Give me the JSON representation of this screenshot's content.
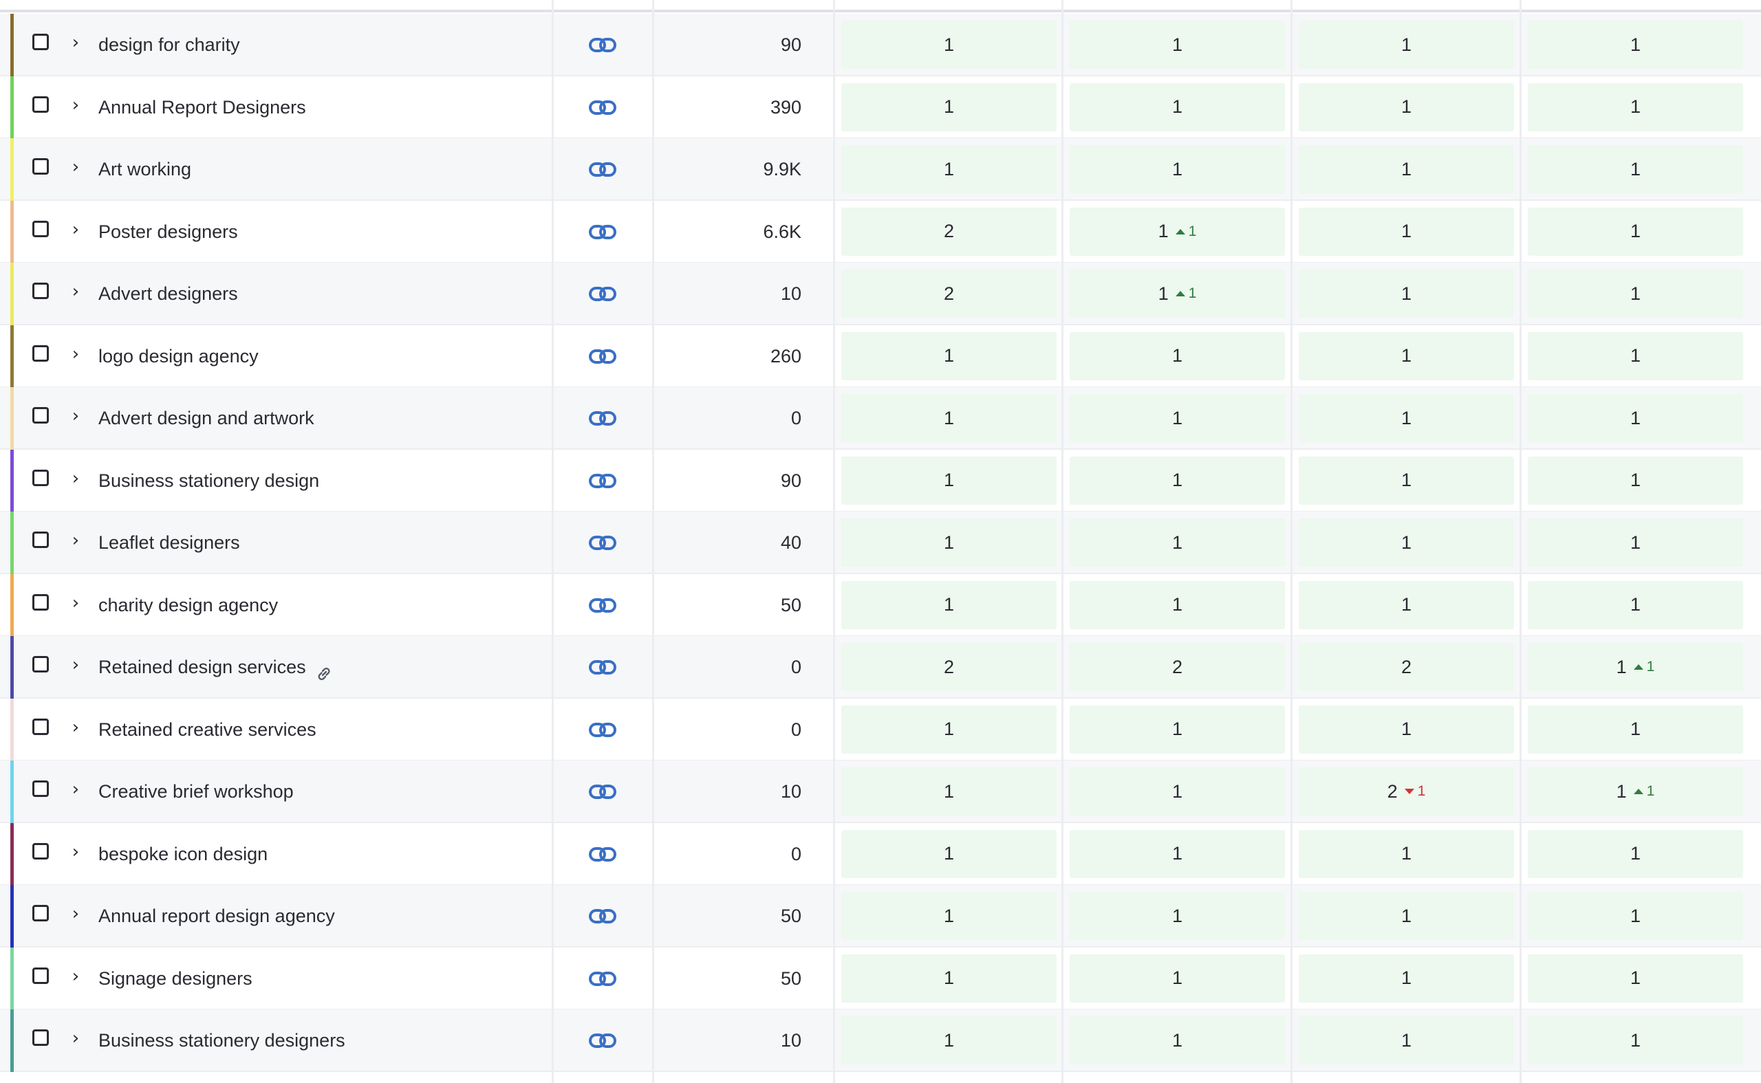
{
  "colors": {
    "accent_link": "#3a6fc4",
    "pos_cell_bg": "#edf8ee",
    "change_up": "#2f7d3f",
    "change_down": "#d0343a"
  },
  "icons": {
    "url": "link-icon",
    "expand": "chevron-right-icon",
    "keyword_link": "link-icon"
  },
  "rows": [
    {
      "keyword": "design for charity",
      "volume": "90",
      "stripe": "#8a6c2e",
      "positions": [
        {
          "value": "1",
          "change": "",
          "dir": ""
        },
        {
          "value": "1",
          "change": "",
          "dir": ""
        },
        {
          "value": "1",
          "change": "",
          "dir": ""
        },
        {
          "value": "1",
          "change": "",
          "dir": ""
        }
      ]
    },
    {
      "keyword": "Annual Report Designers",
      "volume": "390",
      "stripe": "#6fd35a",
      "positions": [
        {
          "value": "1",
          "change": "",
          "dir": ""
        },
        {
          "value": "1",
          "change": "",
          "dir": ""
        },
        {
          "value": "1",
          "change": "",
          "dir": ""
        },
        {
          "value": "1",
          "change": "",
          "dir": ""
        }
      ]
    },
    {
      "keyword": "Art working",
      "volume": "9.9K",
      "stripe": "#f0ef63",
      "positions": [
        {
          "value": "1",
          "change": "",
          "dir": ""
        },
        {
          "value": "1",
          "change": "",
          "dir": ""
        },
        {
          "value": "1",
          "change": "",
          "dir": ""
        },
        {
          "value": "1",
          "change": "",
          "dir": ""
        }
      ]
    },
    {
      "keyword": "Poster designers",
      "volume": "6.6K",
      "stripe": "#efb98f",
      "positions": [
        {
          "value": "2",
          "change": "",
          "dir": ""
        },
        {
          "value": "1",
          "change": "1",
          "dir": "up"
        },
        {
          "value": "1",
          "change": "",
          "dir": ""
        },
        {
          "value": "1",
          "change": "",
          "dir": ""
        }
      ]
    },
    {
      "keyword": "Advert designers",
      "volume": "10",
      "stripe": "#ecea5c",
      "positions": [
        {
          "value": "2",
          "change": "",
          "dir": ""
        },
        {
          "value": "1",
          "change": "1",
          "dir": "up"
        },
        {
          "value": "1",
          "change": "",
          "dir": ""
        },
        {
          "value": "1",
          "change": "",
          "dir": ""
        }
      ]
    },
    {
      "keyword": "logo design agency",
      "volume": "260",
      "stripe": "#8d7a35",
      "positions": [
        {
          "value": "1",
          "change": "",
          "dir": ""
        },
        {
          "value": "1",
          "change": "",
          "dir": ""
        },
        {
          "value": "1",
          "change": "",
          "dir": ""
        },
        {
          "value": "1",
          "change": "",
          "dir": ""
        }
      ]
    },
    {
      "keyword": "Advert design and artwork",
      "volume": "0",
      "stripe": "#f3d9a3",
      "positions": [
        {
          "value": "1",
          "change": "",
          "dir": ""
        },
        {
          "value": "1",
          "change": "",
          "dir": ""
        },
        {
          "value": "1",
          "change": "",
          "dir": ""
        },
        {
          "value": "1",
          "change": "",
          "dir": ""
        }
      ]
    },
    {
      "keyword": "Business stationery design",
      "volume": "90",
      "stripe": "#7b4cd6",
      "positions": [
        {
          "value": "1",
          "change": "",
          "dir": ""
        },
        {
          "value": "1",
          "change": "",
          "dir": ""
        },
        {
          "value": "1",
          "change": "",
          "dir": ""
        },
        {
          "value": "1",
          "change": "",
          "dir": ""
        }
      ]
    },
    {
      "keyword": "Leaflet designers",
      "volume": "40",
      "stripe": "#74d86a",
      "positions": [
        {
          "value": "1",
          "change": "",
          "dir": ""
        },
        {
          "value": "1",
          "change": "",
          "dir": ""
        },
        {
          "value": "1",
          "change": "",
          "dir": ""
        },
        {
          "value": "1",
          "change": "",
          "dir": ""
        }
      ]
    },
    {
      "keyword": "charity design agency",
      "volume": "50",
      "stripe": "#f2a94e",
      "positions": [
        {
          "value": "1",
          "change": "",
          "dir": ""
        },
        {
          "value": "1",
          "change": "",
          "dir": ""
        },
        {
          "value": "1",
          "change": "",
          "dir": ""
        },
        {
          "value": "1",
          "change": "",
          "dir": ""
        }
      ]
    },
    {
      "keyword": "Retained design services",
      "volume": "0",
      "stripe": "#4b4aa8",
      "keyword_link": true,
      "positions": [
        {
          "value": "2",
          "change": "",
          "dir": ""
        },
        {
          "value": "2",
          "change": "",
          "dir": ""
        },
        {
          "value": "2",
          "change": "",
          "dir": ""
        },
        {
          "value": "1",
          "change": "1",
          "dir": "up"
        }
      ]
    },
    {
      "keyword": "Retained creative services",
      "volume": "0",
      "stripe": "#f2dada",
      "positions": [
        {
          "value": "1",
          "change": "",
          "dir": ""
        },
        {
          "value": "1",
          "change": "",
          "dir": ""
        },
        {
          "value": "1",
          "change": "",
          "dir": ""
        },
        {
          "value": "1",
          "change": "",
          "dir": ""
        }
      ]
    },
    {
      "keyword": "Creative brief workshop",
      "volume": "10",
      "stripe": "#6cd5ef",
      "positions": [
        {
          "value": "1",
          "change": "",
          "dir": ""
        },
        {
          "value": "1",
          "change": "",
          "dir": ""
        },
        {
          "value": "2",
          "change": "1",
          "dir": "down"
        },
        {
          "value": "1",
          "change": "1",
          "dir": "up"
        }
      ]
    },
    {
      "keyword": "bespoke icon design",
      "volume": "0",
      "stripe": "#8b2a57",
      "positions": [
        {
          "value": "1",
          "change": "",
          "dir": ""
        },
        {
          "value": "1",
          "change": "",
          "dir": ""
        },
        {
          "value": "1",
          "change": "",
          "dir": ""
        },
        {
          "value": "1",
          "change": "",
          "dir": ""
        }
      ]
    },
    {
      "keyword": "Annual report design agency",
      "volume": "50",
      "stripe": "#2532b6",
      "positions": [
        {
          "value": "1",
          "change": "",
          "dir": ""
        },
        {
          "value": "1",
          "change": "",
          "dir": ""
        },
        {
          "value": "1",
          "change": "",
          "dir": ""
        },
        {
          "value": "1",
          "change": "",
          "dir": ""
        }
      ]
    },
    {
      "keyword": "Signage designers",
      "volume": "50",
      "stripe": "#76d8a0",
      "positions": [
        {
          "value": "1",
          "change": "",
          "dir": ""
        },
        {
          "value": "1",
          "change": "",
          "dir": ""
        },
        {
          "value": "1",
          "change": "",
          "dir": ""
        },
        {
          "value": "1",
          "change": "",
          "dir": ""
        }
      ]
    },
    {
      "keyword": "Business stationery designers",
      "volume": "10",
      "stripe": "#4a9c93",
      "positions": [
        {
          "value": "1",
          "change": "",
          "dir": ""
        },
        {
          "value": "1",
          "change": "",
          "dir": ""
        },
        {
          "value": "1",
          "change": "",
          "dir": ""
        },
        {
          "value": "1",
          "change": "",
          "dir": ""
        }
      ]
    }
  ]
}
